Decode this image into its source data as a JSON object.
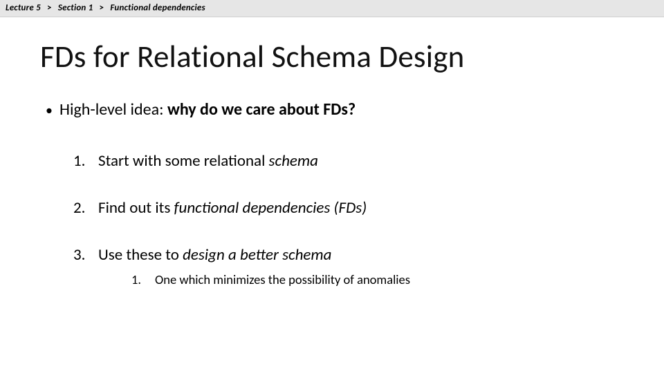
{
  "breadcrumb": {
    "part1": "Lecture 5",
    "sep1": ">",
    "part2": "Section 1",
    "sep2": ">",
    "part3": "Functional dependencies"
  },
  "title": "FDs for Relational Schema Design",
  "bullet": {
    "lead": "High-level idea: ",
    "bold": "why do we care about FDs?"
  },
  "steps": [
    {
      "num": "1.",
      "lead": "Start with some relational ",
      "em": "schema"
    },
    {
      "num": "2.",
      "lead": "Find out its ",
      "em": "functional dependencies (FDs)"
    },
    {
      "num": "3.",
      "lead": "Use these to ",
      "em": "design a better schema"
    }
  ],
  "sub": {
    "num": "1.",
    "text": "One which minimizes the possibility of anomalies"
  }
}
